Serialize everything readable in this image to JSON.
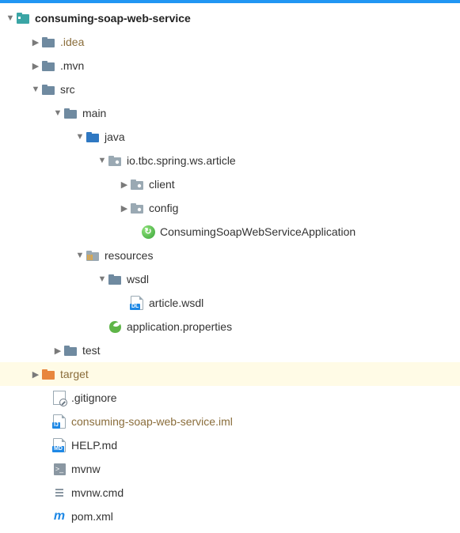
{
  "tree": {
    "root": "consuming-soap-web-service",
    "idea": ".idea",
    "mvn": ".mvn",
    "src": "src",
    "main": "main",
    "java": "java",
    "package": "io.tbc.spring.ws.article",
    "client": "client",
    "config": "config",
    "app_class": "ConsumingSoapWebServiceApplication",
    "resources": "resources",
    "wsdl": "wsdl",
    "article_wsdl": "article.wsdl",
    "app_props": "application.properties",
    "test": "test",
    "target": "target",
    "gitignore": ".gitignore",
    "iml": "consuming-soap-web-service.iml",
    "help": "HELP.md",
    "mvnw": "mvnw",
    "mvnw_cmd": "mvnw.cmd",
    "pom": "pom.xml"
  }
}
